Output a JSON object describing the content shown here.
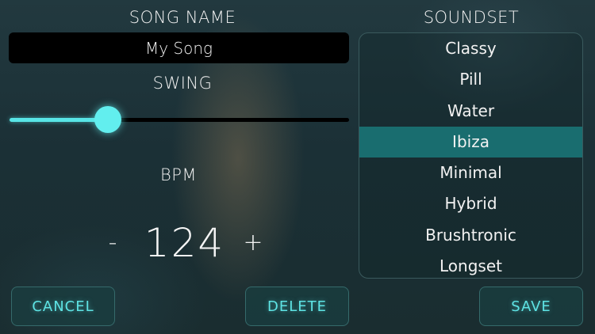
{
  "song": {
    "label": "SONG NAME",
    "value": "My Song"
  },
  "swing": {
    "label": "SWING",
    "value": 0.29
  },
  "bpm": {
    "label": "BPM",
    "decrement_label": "-",
    "value": "124",
    "increment_label": "+"
  },
  "buttons": {
    "cancel_label": "CANCEL",
    "delete_label": "DELETE",
    "save_label": "SAVE"
  },
  "soundset": {
    "label": "SOUNDSET",
    "selected": "Ibiza",
    "items": [
      "Classy",
      "Pill",
      "Water",
      "Ibiza",
      "Minimal",
      "Hybrid",
      "Brushtronic",
      "Longset"
    ]
  },
  "colors": {
    "accent": "#5ee3e4",
    "selected_row": "#196d6f",
    "input_background": "#000000"
  }
}
